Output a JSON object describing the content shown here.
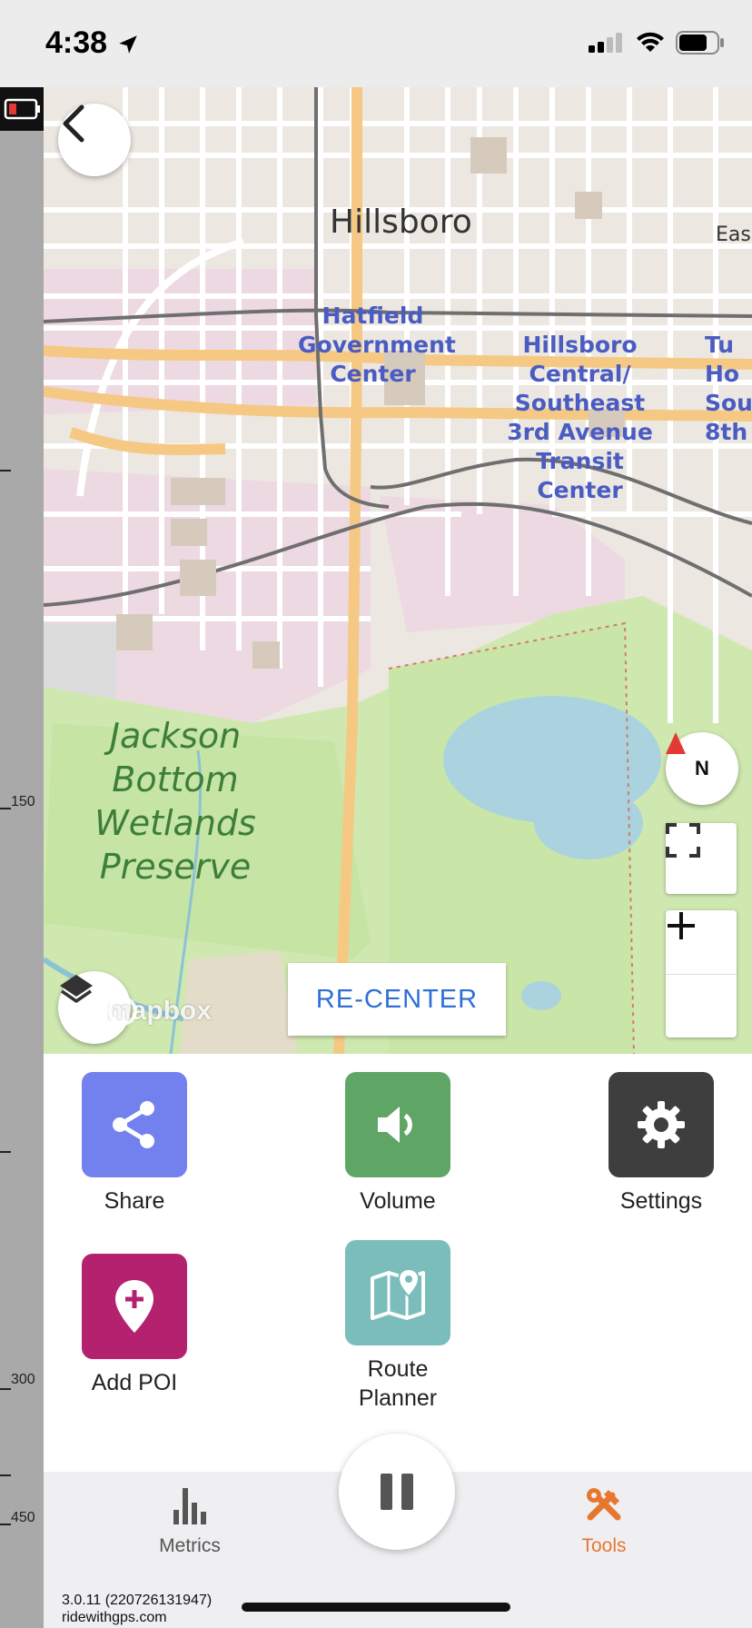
{
  "status_bar": {
    "time": "4:38",
    "icons": [
      "location-arrow-icon",
      "cellular-signal-icon",
      "wifi-icon",
      "battery-icon"
    ]
  },
  "left_strip": {
    "tick_labels": [
      "150",
      "300",
      "450"
    ]
  },
  "map": {
    "labels": {
      "city": "Hillsboro",
      "city_partial": "Eas",
      "station1": [
        "Hatfield",
        "Government",
        "Center"
      ],
      "station2": [
        "Hillsboro",
        "Central/",
        "Southeast",
        "3rd Avenue",
        "Transit",
        "Center"
      ],
      "station3": [
        "Tu",
        "Ho",
        "Sou",
        "8th"
      ],
      "park": [
        "Jackson",
        "Bottom",
        "Wetlands",
        "Preserve"
      ]
    },
    "attribution": "mapbox",
    "recenter_label": "RE-CENTER",
    "compass_label": "N"
  },
  "tools": {
    "share": "Share",
    "volume": "Volume",
    "settings": "Settings",
    "add_poi": "Add POI",
    "route_planner_line1": "Route",
    "route_planner_line2": "Planner"
  },
  "colors": {
    "share": "#7381ee",
    "volume": "#5fa566",
    "settings": "#3e3e3e",
    "add_poi": "#b4226f",
    "route_planner": "#7bbdbb",
    "active_tab": "#e8772e"
  },
  "bottom_nav": {
    "metrics": "Metrics",
    "tools": "Tools"
  },
  "footer": {
    "version": "3.0.11 (220726131947)",
    "site": "ridewithgps.com"
  }
}
